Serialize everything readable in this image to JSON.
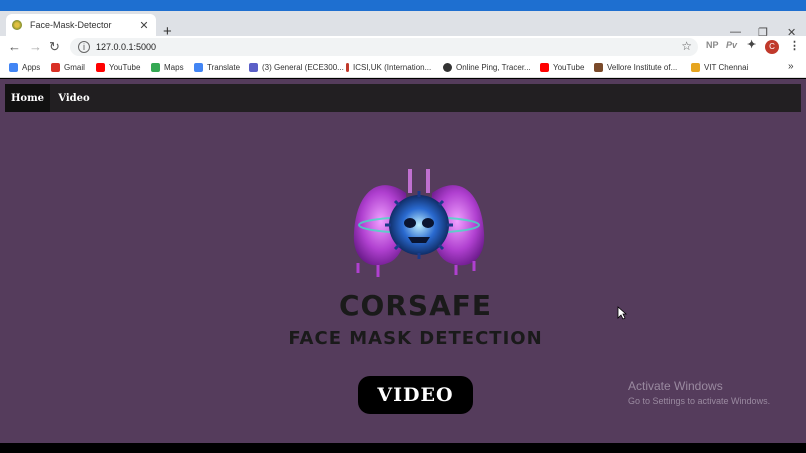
{
  "browser": {
    "tab_title": "Face-Mask-Detector",
    "tab_close": "✕",
    "new_tab": "+",
    "url": "127.0.0.1:5000",
    "window_controls": {
      "minimize": "—",
      "restore": "❐",
      "close": "✕"
    },
    "extensions": [
      "NP",
      "Pv"
    ],
    "avatar_letter": "C",
    "more": "⋮"
  },
  "bookmarks": [
    {
      "label": "Apps",
      "color": "#4285f4"
    },
    {
      "label": "Gmail",
      "color": "#d93025"
    },
    {
      "label": "YouTube",
      "color": "#ff0000"
    },
    {
      "label": "Maps",
      "color": "#34a853"
    },
    {
      "label": "Translate",
      "color": "#4285f4"
    },
    {
      "label": "(3) General (ECE300...",
      "color": "#5b5fc7"
    },
    {
      "label": "ICSI,UK (Internation...",
      "color": "#c0392b"
    },
    {
      "label": "Online Ping, Tracer...",
      "color": "#333333"
    },
    {
      "label": "YouTube",
      "color": "#ff0000"
    },
    {
      "label": "Vellore Institute of...",
      "color": "#7a4a2a"
    },
    {
      "label": "VIT Chennai",
      "color": "#e6a520"
    }
  ],
  "bookmarks_overflow": "»",
  "site": {
    "nav": {
      "home": "Home",
      "video": "Video"
    },
    "brand": "CORSAFE",
    "subtitle": "FACE MASK DETECTION",
    "video_button": "VIDEO"
  },
  "watermark": {
    "line1": "Activate Windows",
    "line2": "Go to Settings to activate Windows."
  },
  "colors": {
    "page_bg": "#553c5c",
    "navbar_bg": "#221f22",
    "accent_blue": "#1e6fd0"
  }
}
